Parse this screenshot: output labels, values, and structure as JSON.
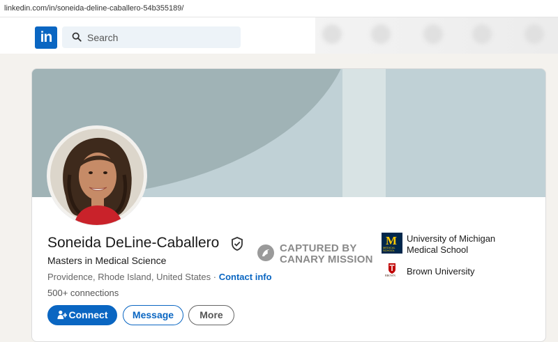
{
  "browser": {
    "url": "linkedin.com/in/soneida-deline-caballero-54b355189/"
  },
  "nav": {
    "logo": "in",
    "search_placeholder": "Search"
  },
  "profile": {
    "name": "Soneida DeLine-Caballero",
    "headline": "Masters in Medical Science",
    "location": "Providence, Rhode Island, United States",
    "separator": " · ",
    "contact_label": "Contact info",
    "connections": "500+ connections"
  },
  "actions": {
    "connect": "Connect",
    "message": "Message",
    "more": "More"
  },
  "watermark": {
    "line1": "CAPTURED BY",
    "line2": "CANARY MISSION"
  },
  "education": [
    {
      "name_line1": "University of Michigan",
      "name_line2": "Medical School",
      "logo_letter": "M",
      "logo_caption": "MEDICAL SCHOOL"
    },
    {
      "name": "Brown University",
      "logo_caption": "BROWN"
    }
  ],
  "colors": {
    "brand": "#0a66c2",
    "banner": "#a0b3b6",
    "banner_light": "#c0d1d6",
    "umich_blue": "#00274c",
    "umich_maize": "#ffcb05",
    "brown_red": "#c00404"
  }
}
